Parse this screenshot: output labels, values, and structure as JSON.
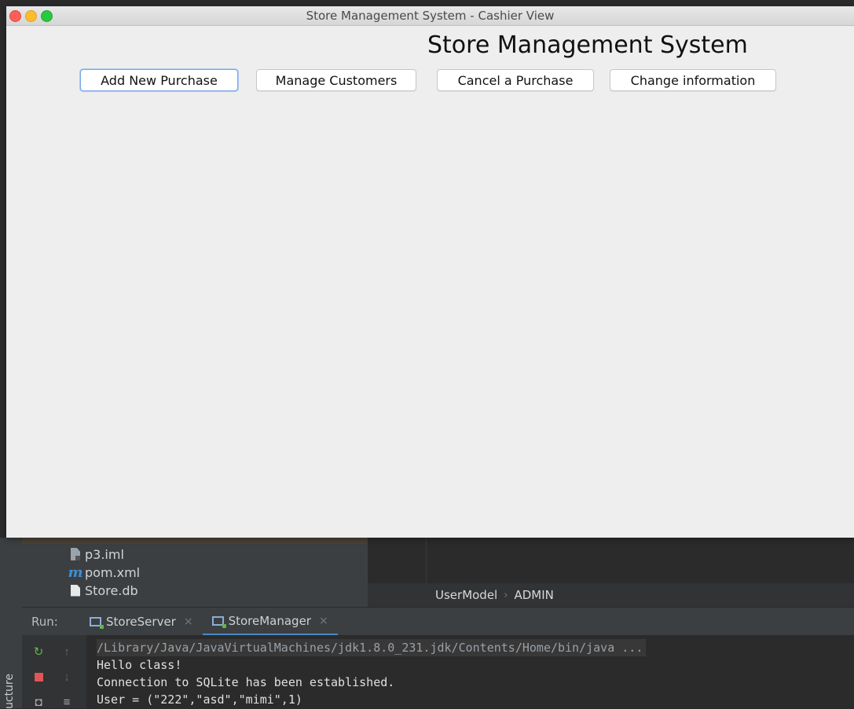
{
  "window": {
    "title": "Store Management System - Cashier View",
    "heading": "Store Management System",
    "buttons": [
      {
        "label": "Add New Purchase",
        "focused": true
      },
      {
        "label": "Manage Customers"
      },
      {
        "label": "Cancel a Purchase"
      },
      {
        "label": "Change information"
      }
    ]
  },
  "ide": {
    "project_files": [
      {
        "name": "p3.iml",
        "icon": "iml-file-icon"
      },
      {
        "name": "pom.xml",
        "icon": "maven-icon"
      },
      {
        "name": "Store.db",
        "icon": "db-file-icon"
      }
    ],
    "breadcrumb": [
      "UserModel",
      "ADMIN"
    ],
    "run": {
      "label": "Run:",
      "tabs": [
        {
          "label": "StoreServer"
        },
        {
          "label": "StoreManager",
          "active": true
        }
      ]
    },
    "console_lines": [
      "/Library/Java/JavaVirtualMachines/jdk1.8.0_231.jdk/Contents/Home/bin/java ...",
      "Hello class!",
      "Connection to SQLite has been established.",
      "User = (\"222\",\"asd\",\"mimi\",1)"
    ],
    "side_tab": "ucture"
  },
  "colors": {
    "accent": "#4a88c7",
    "rerun": "#5fb848",
    "stop": "#e05555"
  }
}
